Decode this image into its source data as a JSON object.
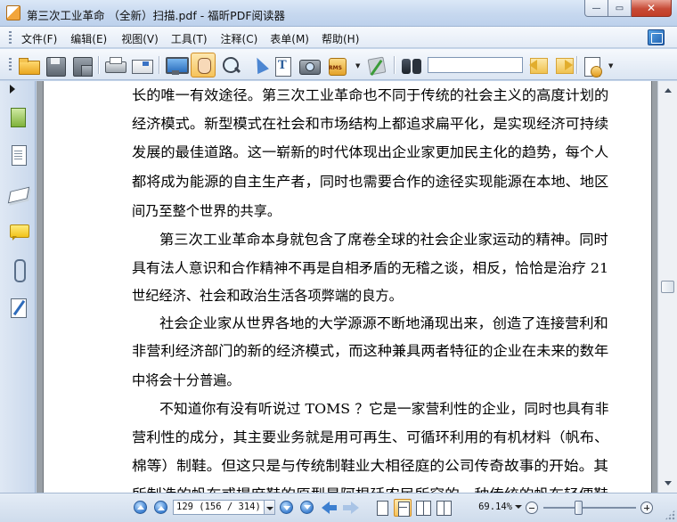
{
  "window": {
    "title": "第三次工业革命 （全新）扫描.pdf - 福昕PDF阅读器",
    "minimize_glyph": "—",
    "maximize_glyph": "▭",
    "close_glyph": "✕"
  },
  "menu": {
    "items": [
      {
        "label": "文件(F)"
      },
      {
        "label": "编辑(E)"
      },
      {
        "label": "视图(V)"
      },
      {
        "label": "工具(T)"
      },
      {
        "label": "注释(C)"
      },
      {
        "label": "表单(M)"
      },
      {
        "label": "帮助(H)"
      }
    ]
  },
  "toolbar": {
    "icons": [
      "open-icon",
      "save-icon",
      "save-as-icon",
      "print-icon",
      "email-icon",
      "full-screen-icon",
      "hand-tool-icon",
      "zoom-tool-icon",
      "select-tool-icon",
      "text-select-icon",
      "snapshot-icon",
      "rms-icon",
      "sign-icon",
      "find-icon",
      "prev-result-icon",
      "next-result-icon",
      "advanced-search-icon"
    ],
    "search_value": "",
    "active_tool": "hand-tool-icon"
  },
  "nav_panel": {
    "icons": [
      "pages-icon",
      "bookmarks-icon",
      "layers-icon",
      "comments-icon",
      "attachments-icon",
      "signatures-icon"
    ]
  },
  "document": {
    "lines": [
      "长的唯一有效途径。第三次工业革命也不同于传统的社会主义的高度计划的",
      "经济模式。新型模式在社会和市场结构上都追求扁平化，是实现经济可持续",
      "发展的最佳道路。这一崭新的时代体现出企业家更加民主化的趋势，每个人",
      "都将成为能源的自主生产者，同时也需要合作的途径实现能源在本地、地区",
      "间乃至整个世界的共享。",
      "第三次工业革命本身就包含了席卷全球的社会企业家运动的精神。同时",
      "具有法人意识和合作精神不再是自相矛盾的无稽之谈，相反，恰恰是治疗 21",
      "世纪经济、社会和政治生活各项弊端的良方。",
      "社会企业家从世界各地的大学源源不断地涌现出来，创造了连接营利和",
      "非营利经济部门的新的经济模式，而这种兼具两者特征的企业在未来的数年",
      "中将会十分普遍。",
      "不知道你有没有听说过 TOMS ？它是一家营利性的企业，同时也具有非",
      "营利性的成分，其主要业务就是用可再生、可循环利用的有机材料（帆布、",
      "棉等）制鞋。但这只是与传统制鞋业大相径庭的公司传奇故事的开始。其",
      "所制造的帆布或提麻鞋的原型是阿根廷农民所穿的一种传统的帆布轻便鞋"
    ]
  },
  "statusbar": {
    "page_display": "129 (156 / 314)",
    "current_page": 156,
    "total_pages": 314,
    "zoom": "69.14%",
    "zoom_slider_fraction": 0.38,
    "active_view": "continuous"
  },
  "colors": {
    "chrome": "#c5d5ea",
    "page_background": "#ffffff",
    "workspace": "#9aa0a6",
    "close_button": "#c74b36"
  }
}
